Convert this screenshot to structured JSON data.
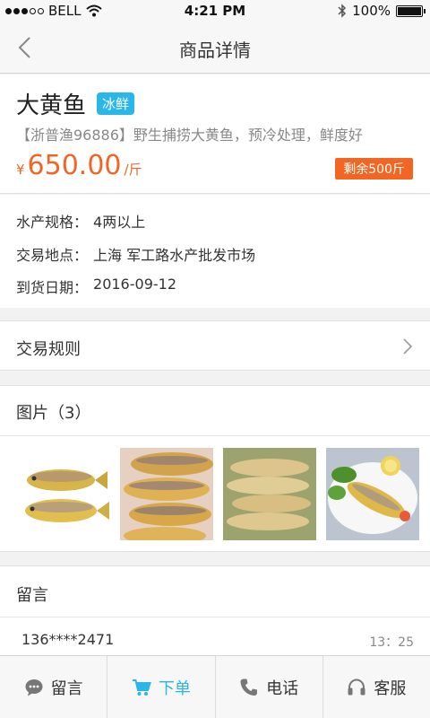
{
  "status_bar": {
    "carrier": "BELL",
    "time": "4:21 PM",
    "battery": "100%",
    "battery_level": 1.0
  },
  "nav": {
    "title": "商品详情"
  },
  "product": {
    "name": "大黄鱼",
    "tag": "冰鲜",
    "description": "【浙普渔96886】野生捕捞大黄鱼，预冷处理，鲜度好",
    "currency": "¥",
    "price": "650.00",
    "unit": "/斤",
    "stock": "剩余500斤"
  },
  "specs": [
    {
      "label": "水产规格：",
      "value": "4两以上"
    },
    {
      "label": "交易地点：",
      "value": "上海 军工路水产批发市场"
    },
    {
      "label": "到货日期：",
      "value": "2016-09-12"
    }
  ],
  "rules": {
    "label": "交易规则"
  },
  "photos": {
    "label": "图片（3）",
    "items": [
      "two-yellow-croakers",
      "croakers-pile",
      "croakers-tray",
      "croaker-plate"
    ]
  },
  "comments": {
    "label": "留言",
    "items": [
      {
        "user": "136****2471",
        "time": "13：25"
      }
    ]
  },
  "tabs": [
    {
      "label": "留言",
      "icon": "chat-icon"
    },
    {
      "label": "下单",
      "icon": "cart-icon"
    },
    {
      "label": "电话",
      "icon": "phone-icon"
    },
    {
      "label": "客服",
      "icon": "headset-icon"
    }
  ],
  "colors": {
    "accent": "#29b6e8",
    "price": "#f26522"
  }
}
